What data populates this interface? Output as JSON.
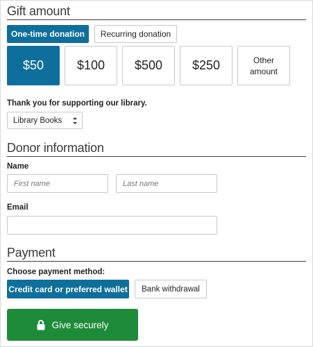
{
  "gift": {
    "title": "Gift amount",
    "frequency": {
      "one_time": "One-time donation",
      "recurring": "Recurring donation"
    },
    "amounts": [
      "$50",
      "$100",
      "$500",
      "$250"
    ],
    "other_line1": "Other",
    "other_line2": "amount",
    "thanks": "Thank you for supporting our library.",
    "designation_selected": "Library Books"
  },
  "donor": {
    "title": "Donor information",
    "name_label": "Name",
    "first_placeholder": "First name",
    "last_placeholder": "Last name",
    "email_label": "Email",
    "email_value": ""
  },
  "payment": {
    "title": "Payment",
    "method_label": "Choose payment method:",
    "card": "Credit card or preferred wallet",
    "bank": "Bank withdrawal"
  },
  "submit": {
    "label": "Give securely",
    "icon": "lock-icon"
  },
  "colors": {
    "primary": "#0f6f9c",
    "submit": "#1e8b3a"
  }
}
